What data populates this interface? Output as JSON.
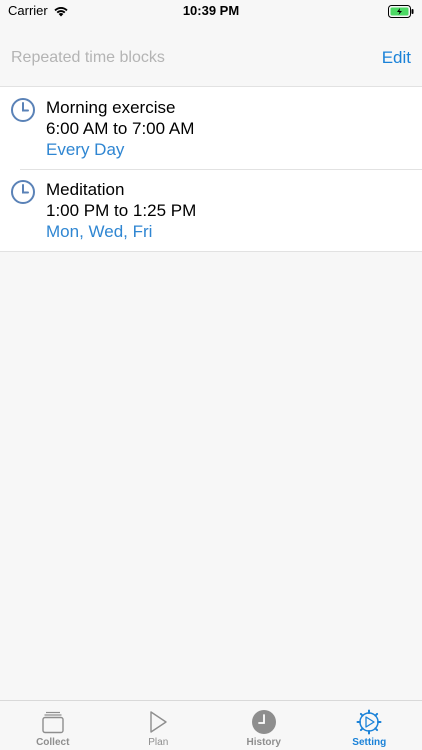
{
  "status_bar": {
    "carrier": "Carrier",
    "time": "10:39 PM"
  },
  "nav": {
    "title": "Repeated time blocks",
    "edit_label": "Edit"
  },
  "blocks": [
    {
      "name": "Morning exercise",
      "time": "6:00 AM to 7:00 AM",
      "days": "Every Day",
      "icon": "clock-icon"
    },
    {
      "name": "Meditation",
      "time": "1:00 PM to 1:25 PM",
      "days": "Mon, Wed, Fri",
      "icon": "clock-icon"
    }
  ],
  "tabs": [
    {
      "label": "Collect",
      "icon": "stack-icon",
      "active": false
    },
    {
      "label": "Plan",
      "icon": "play-icon",
      "active": false
    },
    {
      "label": "History",
      "icon": "clock-filled-icon",
      "active": false
    },
    {
      "label": "Setting",
      "icon": "gear-icon",
      "active": true
    }
  ],
  "colors": {
    "accent": "#1a82d8",
    "days_text": "#2f86d2",
    "icon_blue": "#5a82b7",
    "inactive": "#8e8e8e",
    "battery_green": "#4cd964"
  }
}
